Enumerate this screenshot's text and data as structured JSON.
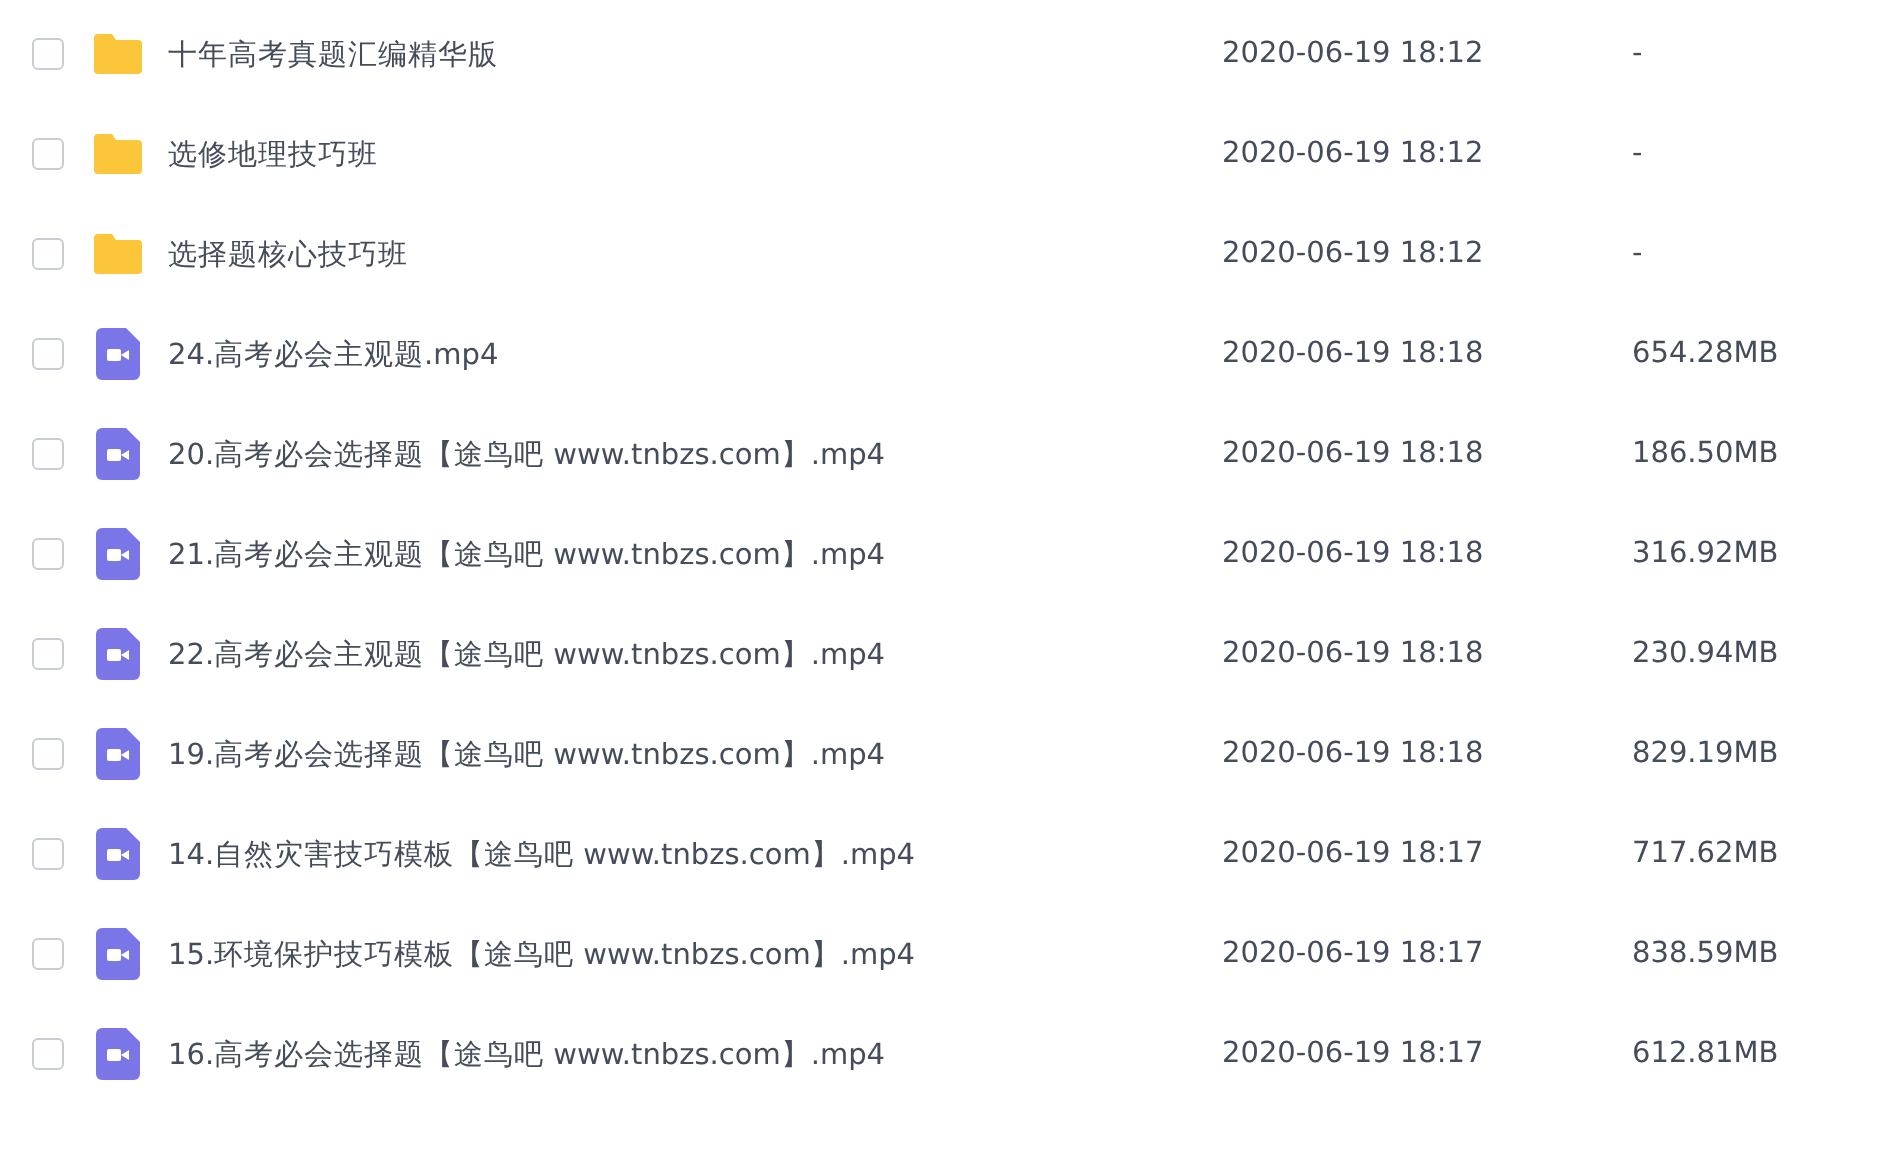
{
  "files": [
    {
      "kind": "folder",
      "name": "十年高考真题汇编精华版",
      "modified": "2020-06-19 18:12",
      "size": "-",
      "checked": false
    },
    {
      "kind": "folder",
      "name": "选修地理技巧班",
      "modified": "2020-06-19 18:12",
      "size": "-",
      "checked": false
    },
    {
      "kind": "folder",
      "name": "选择题核心技巧班",
      "modified": "2020-06-19 18:12",
      "size": "-",
      "checked": false
    },
    {
      "kind": "video",
      "name": "24.高考必会主观题.mp4",
      "modified": "2020-06-19 18:18",
      "size": "654.28MB",
      "checked": false
    },
    {
      "kind": "video",
      "name": "20.高考必会选择题【途鸟吧 www.tnbzs.com】.mp4",
      "modified": "2020-06-19 18:18",
      "size": "186.50MB",
      "checked": false
    },
    {
      "kind": "video",
      "name": "21.高考必会主观题【途鸟吧 www.tnbzs.com】.mp4",
      "modified": "2020-06-19 18:18",
      "size": "316.92MB",
      "checked": false
    },
    {
      "kind": "video",
      "name": "22.高考必会主观题【途鸟吧 www.tnbzs.com】.mp4",
      "modified": "2020-06-19 18:18",
      "size": "230.94MB",
      "checked": false
    },
    {
      "kind": "video",
      "name": "19.高考必会选择题【途鸟吧 www.tnbzs.com】.mp4",
      "modified": "2020-06-19 18:18",
      "size": "829.19MB",
      "checked": false
    },
    {
      "kind": "video",
      "name": "14.自然灾害技巧模板【途鸟吧 www.tnbzs.com】.mp4",
      "modified": "2020-06-19 18:17",
      "size": "717.62MB",
      "checked": false
    },
    {
      "kind": "video",
      "name": "15.环境保护技巧模板【途鸟吧 www.tnbzs.com】.mp4",
      "modified": "2020-06-19 18:17",
      "size": "838.59MB",
      "checked": false
    },
    {
      "kind": "video",
      "name": "16.高考必会选择题【途鸟吧 www.tnbzs.com】.mp4",
      "modified": "2020-06-19 18:17",
      "size": "612.81MB",
      "checked": false
    }
  ]
}
